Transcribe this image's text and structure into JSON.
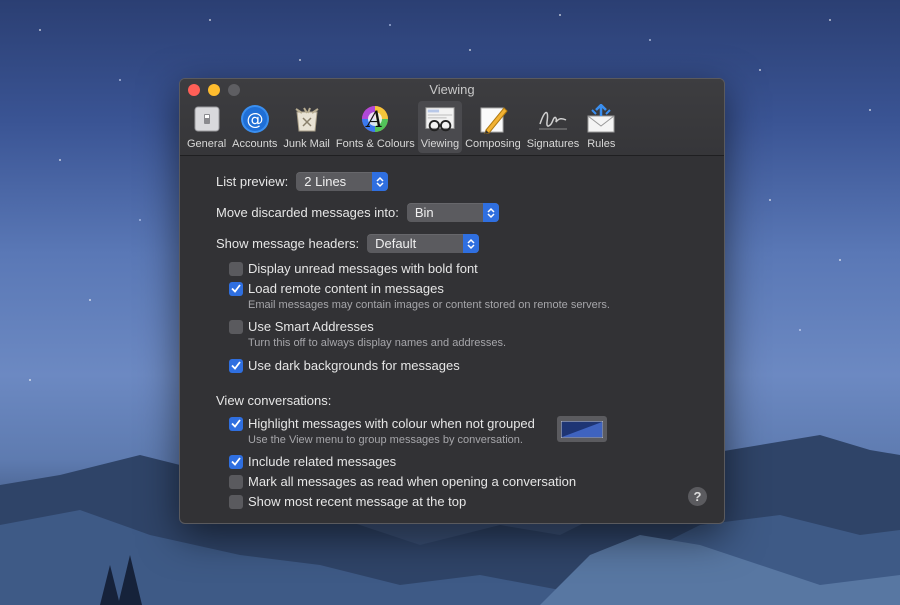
{
  "window": {
    "title": "Viewing"
  },
  "toolbar": {
    "items": [
      {
        "label": "General",
        "icon": "general-icon"
      },
      {
        "label": "Accounts",
        "icon": "accounts-at-icon"
      },
      {
        "label": "Junk Mail",
        "icon": "junk-mail-icon"
      },
      {
        "label": "Fonts & Colours",
        "icon": "fonts-colours-icon"
      },
      {
        "label": "Viewing",
        "icon": "viewing-glasses-icon",
        "selected": true
      },
      {
        "label": "Composing",
        "icon": "composing-pencil-icon"
      },
      {
        "label": "Signatures",
        "icon": "signature-icon"
      },
      {
        "label": "Rules",
        "icon": "rules-envelope-icon"
      }
    ]
  },
  "settings": {
    "list_preview": {
      "label": "List preview:",
      "value": "2 Lines"
    },
    "move_discarded": {
      "label": "Move discarded messages into:",
      "value": "Bin"
    },
    "show_headers": {
      "label": "Show message headers:",
      "value": "Default"
    },
    "bold_unread": {
      "label": "Display unread messages with bold font",
      "checked": false
    },
    "load_remote": {
      "label": "Load remote content in messages",
      "checked": true,
      "note": "Email messages may contain images or content stored on remote servers."
    },
    "smart_addresses": {
      "label": "Use Smart Addresses",
      "checked": false,
      "note": "Turn this off to always display names and addresses."
    },
    "dark_backgrounds": {
      "label": "Use dark backgrounds for messages",
      "checked": true
    }
  },
  "conversations": {
    "heading": "View conversations:",
    "highlight": {
      "label": "Highlight messages with colour when not grouped",
      "checked": true,
      "note": "Use the View menu to group messages by conversation.",
      "color": "#2b4a9a"
    },
    "include_related": {
      "label": "Include related messages",
      "checked": true
    },
    "mark_all_read": {
      "label": "Mark all messages as read when opening a conversation",
      "checked": false
    },
    "recent_top": {
      "label": "Show most recent message at the top",
      "checked": false
    }
  },
  "help": {
    "label": "?"
  },
  "colors": {
    "accent": "#2f6fe0",
    "window_bg": "#323235"
  }
}
